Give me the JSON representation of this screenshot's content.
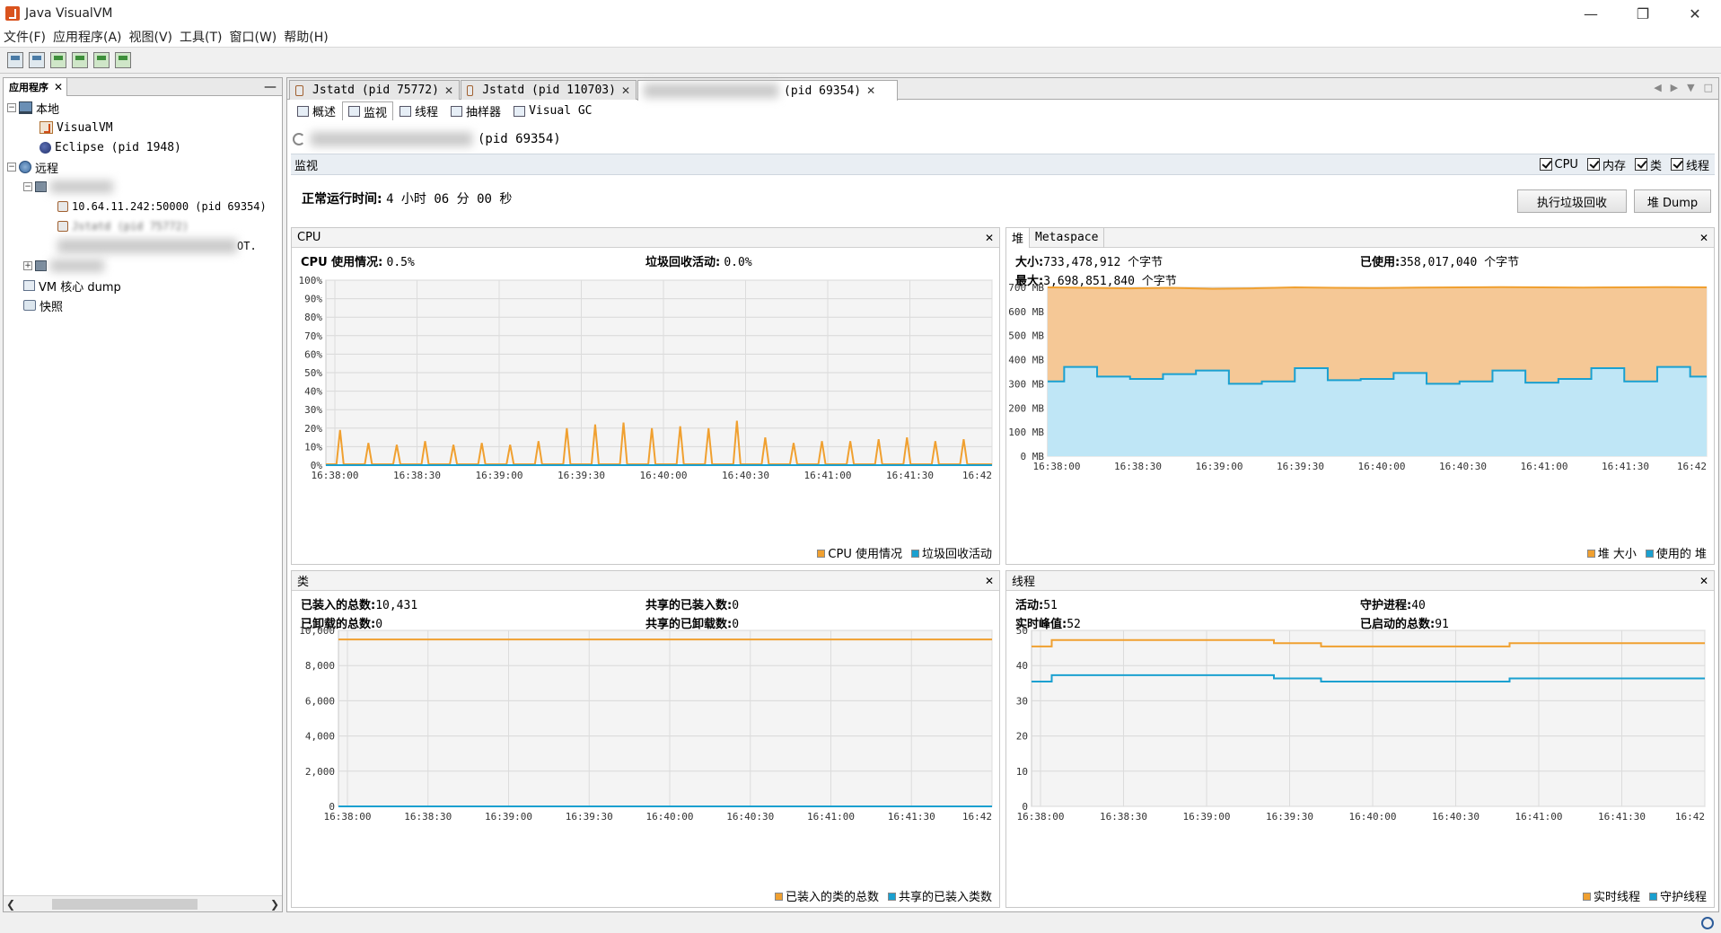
{
  "window": {
    "title": "Java VisualVM",
    "minimize": "—",
    "maximize": "❐",
    "close": "✕"
  },
  "menu": [
    "文件(F)",
    "应用程序(A)",
    "视图(V)",
    "工具(T)",
    "窗口(W)",
    "帮助(H)"
  ],
  "left_panel": {
    "tab_label": "应用程序",
    "tree": {
      "local_label": "本地",
      "local_children": [
        "VisualVM",
        "Eclipse (pid 1948)"
      ],
      "remote_label": "远程",
      "remote_host_child": "10.64.11.242:50000 (pid 69354)",
      "remote_jstatd_child": "Jstatd (pid 75772)",
      "remote_suffix": "OT.",
      "core_dump_label": "VM 核心 dump",
      "snapshot_label": "快照"
    }
  },
  "doc_tabs": [
    {
      "label": "Jstatd (pid 75772)"
    },
    {
      "label": "Jstatd (pid 110703)"
    },
    {
      "label": "(pid 69354)"
    }
  ],
  "sub_tabs": [
    "概述",
    "监视",
    "线程",
    "抽样器",
    "Visual GC"
  ],
  "app_title": "(pid 69354)",
  "monitor": {
    "label": "监视",
    "checks": [
      "CPU",
      "内存",
      "类",
      "线程"
    ],
    "uptime_label": "正常运行时间:",
    "uptime_value": "4 小时 06 分 00 秒",
    "gc_button": "执行垃圾回收",
    "heapdump_button": "堆 Dump"
  },
  "cpu_panel": {
    "title": "CPU",
    "usage_label": "CPU 使用情况:",
    "usage_value": "0.5%",
    "gc_label": "垃圾回收活动:",
    "gc_value": "0.0%",
    "legend": [
      "CPU 使用情况",
      "垃圾回收活动"
    ]
  },
  "heap_panel": {
    "tab_heap": "堆",
    "tab_meta": "Metaspace",
    "size_label": "大小:",
    "size_value": "733,478,912 个字节",
    "max_label": "最大:",
    "max_value": "3,698,851,840 个字节",
    "used_label": "已使用:",
    "used_value": "358,017,040 个字节",
    "legend": [
      "堆 大小",
      "使用的 堆"
    ]
  },
  "classes_panel": {
    "title": "类",
    "loaded_label": "已装入的总数:",
    "loaded_value": "10,431",
    "unloaded_label": "已卸载的总数:",
    "unloaded_value": "0",
    "shared_loaded_label": "共享的已装入数:",
    "shared_loaded_value": "0",
    "shared_unloaded_label": "共享的已卸载数:",
    "shared_unloaded_value": "0",
    "legend": [
      "已装入的类的总数",
      "共享的已装入类数"
    ]
  },
  "threads_panel": {
    "title": "线程",
    "live_label": "活动:",
    "live_value": "51",
    "peak_label": "实时峰值:",
    "peak_value": "52",
    "daemon_label": "守护进程:",
    "daemon_value": "40",
    "started_label": "已启动的总数:",
    "started_value": "91",
    "legend": [
      "实时线程",
      "守护线程"
    ]
  },
  "colors": {
    "orange": "#f0a030",
    "blue": "#1aa0d0",
    "orange_fill": "#f5c896",
    "blue_fill": "#bfe6f6"
  },
  "chart_data": [
    {
      "type": "line",
      "title": "CPU",
      "x": [
        "16:38:00",
        "16:38:30",
        "16:39:00",
        "16:39:30",
        "16:40:00",
        "16:40:30",
        "16:41:00",
        "16:41:30",
        "16:42"
      ],
      "y_ticks": [
        "0%",
        "10%",
        "20%",
        "30%",
        "40%",
        "50%",
        "60%",
        "70%",
        "80%",
        "90%",
        "100%"
      ],
      "ylim": [
        0,
        100
      ],
      "series": [
        {
          "name": "CPU 使用情况",
          "spikes": [
            19,
            12,
            11,
            13,
            11,
            12,
            11,
            13,
            20,
            22,
            23,
            20,
            21,
            20,
            24,
            15,
            12,
            13,
            13,
            14,
            15,
            13,
            14
          ]
        },
        {
          "name": "垃圾回收活动",
          "spikes": [
            0
          ]
        }
      ]
    },
    {
      "type": "area",
      "title": "堆",
      "x": [
        "16:38:00",
        "16:38:30",
        "16:39:00",
        "16:39:30",
        "16:40:00",
        "16:40:30",
        "16:41:00",
        "16:41:30",
        "16:42"
      ],
      "y_ticks": [
        "0 MB",
        "100 MB",
        "200 MB",
        "300 MB",
        "400 MB",
        "500 MB",
        "600 MB",
        "700 MB"
      ],
      "ylim": [
        0,
        700
      ],
      "series": [
        {
          "name": "堆 大小",
          "values": [
            700,
            698,
            696,
            698,
            694,
            696,
            700,
            698,
            697,
            699,
            700,
            701,
            700,
            699,
            700,
            701,
            700
          ]
        },
        {
          "name": "使用的 堆",
          "values": [
            310,
            370,
            330,
            320,
            340,
            355,
            300,
            310,
            365,
            315,
            320,
            345,
            300,
            310,
            355,
            305,
            320,
            365,
            310,
            370,
            330
          ]
        }
      ]
    },
    {
      "type": "line",
      "title": "类",
      "x": [
        "16:38:00",
        "16:38:30",
        "16:39:00",
        "16:39:30",
        "16:40:00",
        "16:40:30",
        "16:41:00",
        "16:41:30",
        "16:42"
      ],
      "y_ticks": [
        "0",
        "2,000",
        "4,000",
        "6,000",
        "8,000",
        "10,000"
      ],
      "ylim": [
        0,
        11000
      ],
      "series": [
        {
          "name": "已装入的类的总数",
          "values": [
            10431,
            10431
          ]
        },
        {
          "name": "共享的已装入类数",
          "values": [
            0,
            0
          ]
        }
      ]
    },
    {
      "type": "line",
      "title": "线程",
      "x": [
        "16:38:00",
        "16:38:30",
        "16:39:00",
        "16:39:30",
        "16:40:00",
        "16:40:30",
        "16:41:00",
        "16:41:30",
        "16:42"
      ],
      "y_ticks": [
        "0",
        "10",
        "20",
        "30",
        "40",
        "50"
      ],
      "ylim": [
        0,
        55
      ],
      "series": [
        {
          "name": "实时线程",
          "steps": [
            [
              0,
              50
            ],
            [
              0.03,
              52
            ],
            [
              0.36,
              51
            ],
            [
              0.43,
              50
            ],
            [
              0.71,
              51
            ],
            [
              1,
              51
            ]
          ]
        },
        {
          "name": "守护线程",
          "steps": [
            [
              0,
              39
            ],
            [
              0.03,
              41
            ],
            [
              0.36,
              40
            ],
            [
              0.43,
              39
            ],
            [
              0.71,
              40
            ],
            [
              1,
              40
            ]
          ]
        }
      ]
    }
  ]
}
